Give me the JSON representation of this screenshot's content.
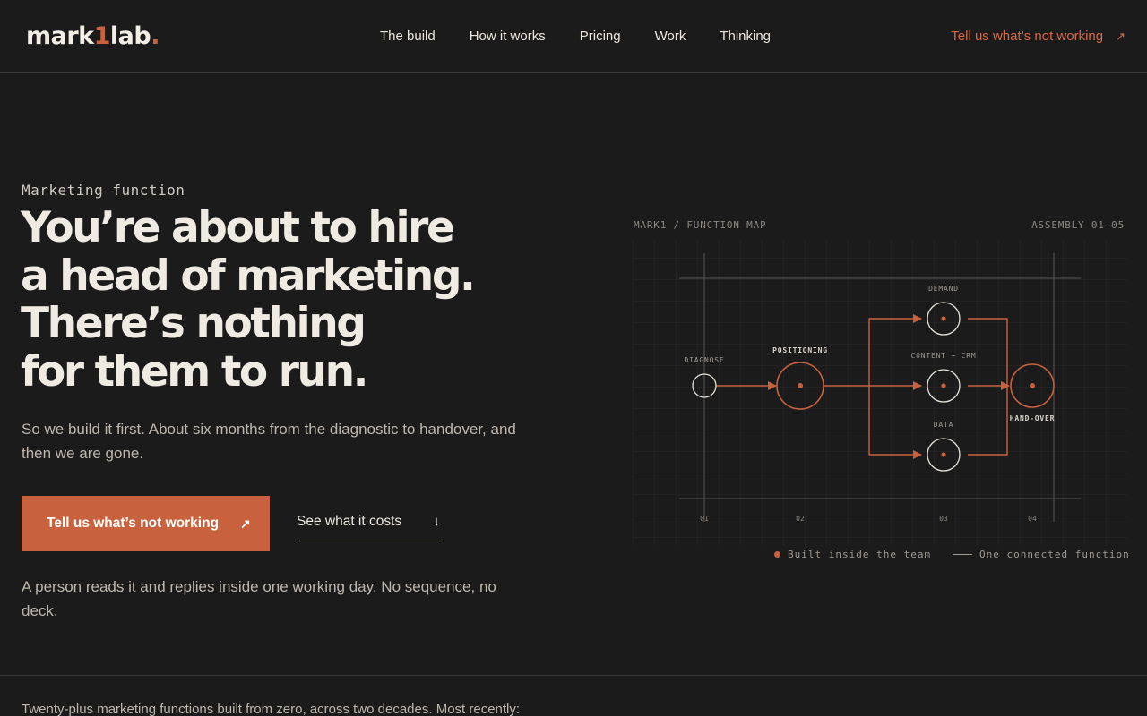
{
  "header": {
    "logo_prefix": "mark",
    "logo_mid": "1",
    "logo_suffix": "lab",
    "logo_dot": ".",
    "nav": [
      "The build",
      "How it works",
      "Pricing",
      "Work",
      "Thinking"
    ],
    "cta_label": "Tell us what’s not working",
    "cta_arrow": "↗"
  },
  "hero": {
    "eyebrow": "Marketing function",
    "headline": [
      "You’re about to hire",
      "a head of marketing.",
      "There’s nothing",
      "for them to run."
    ],
    "lede": "So we build it first. About six months from the diagnostic to handover, and then we are gone.",
    "primary_label": "Tell us what’s not working",
    "primary_arrow": "↗",
    "secondary_label": "See what it costs",
    "secondary_arrow": "↓",
    "note": "A person reads it and replies inside one working day. No sequence, no deck."
  },
  "diagram": {
    "title": "MARK1 / FUNCTION MAP",
    "assembly": "ASSEMBLY 01–05",
    "nodes": {
      "diagnose": "DIAGNOSE",
      "positioning": "POSITIONING",
      "demand": "DEMAND",
      "content": "CONTENT + CRM",
      "data": "DATA",
      "handover": "HAND-OVER"
    },
    "steps": [
      "01",
      "02",
      "03",
      "04"
    ],
    "legend_built": "Built inside the team",
    "legend_connected": "One connected function"
  },
  "footer_strip": {
    "intro": "Twenty-plus marketing functions built from zero, across two decades. Most recently:"
  },
  "colors": {
    "accent": "#c8623e",
    "background": "#1b1b1c",
    "text": "#ece7dd"
  }
}
